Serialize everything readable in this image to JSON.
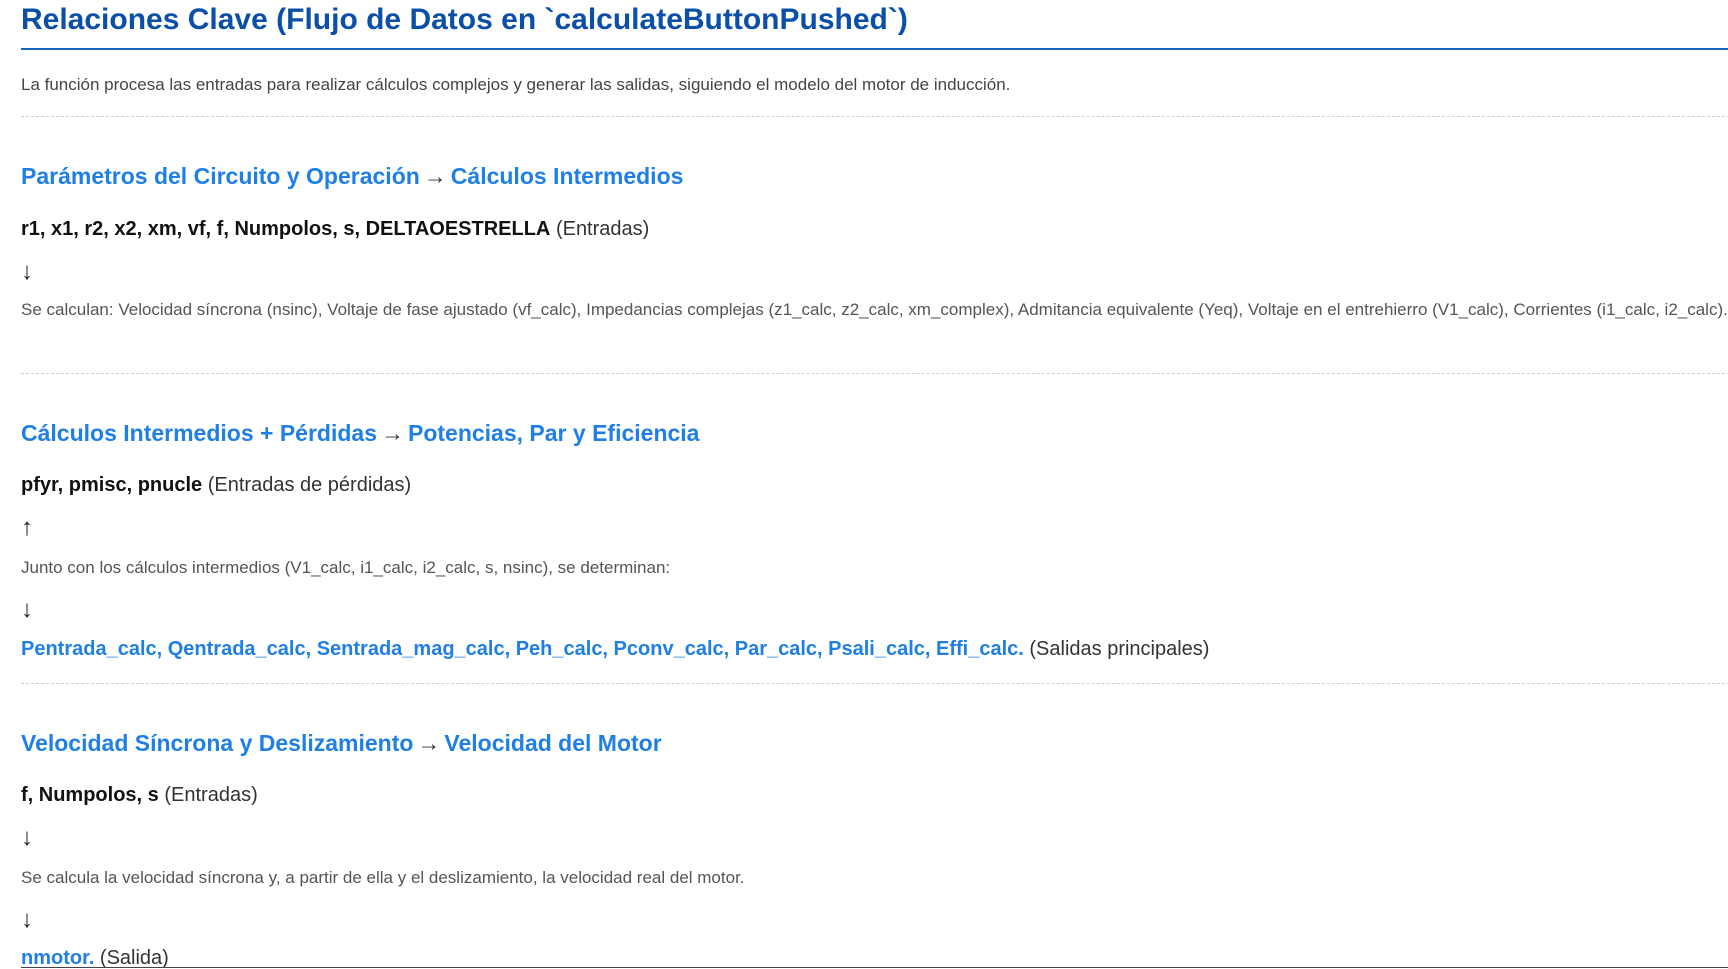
{
  "title": "Relaciones Clave (Flujo de Datos en `calculateButtonPushed`)",
  "intro": "La función procesa las entradas para realizar cálculos complejos y generar las salidas, siguiendo el modelo del motor de inducción.",
  "sections": [
    {
      "title_from": "Parámetros del Circuito y Operación",
      "arrow": "→",
      "title_to": "Cálculos Intermedios",
      "inputs_vars": "r1, x1, r2, x2, xm, vf, f, Numpolos, s, DELTAOESTRELLA",
      "inputs_note": "(Entradas)",
      "flow_arrow_1": "↓",
      "description": "Se calculan: Velocidad síncrona (nsinc), Voltaje de fase ajustado (vf_calc), Impedancias complejas (z1_calc, z2_calc, xm_complex), Admitancia equivalente (Yeq), Voltaje en el entrehierro (V1_calc), Corrientes (i1_calc, i2_calc)."
    },
    {
      "title_from": "Cálculos Intermedios + Pérdidas",
      "arrow": "→",
      "title_to": "Potencias, Par y Eficiencia",
      "inputs_vars": "pfyr, pmisc, pnucle",
      "inputs_note": "(Entradas de pérdidas)",
      "flow_arrow_1": "↑",
      "description": "Junto con los cálculos intermedios (V1_calc, i1_calc, i2_calc, s, nsinc), se determinan:",
      "flow_arrow_2": "↓",
      "outputs_vars": "Pentrada_calc, Qentrada_calc, Sentrada_mag_calc, Peh_calc, Pconv_calc, Par_calc, Psali_calc, Effi_calc.",
      "outputs_note": "(Salidas principales)"
    },
    {
      "title_from": "Velocidad Síncrona y Deslizamiento",
      "arrow": "→",
      "title_to": "Velocidad del Motor",
      "inputs_vars": "f, Numpolos, s",
      "inputs_note": "(Entradas)",
      "flow_arrow_1": "↓",
      "description": "Se calcula la velocidad síncrona y, a partir de ella y el deslizamiento, la velocidad real del motor.",
      "flow_arrow_2": "↓",
      "outputs_vars": "nmotor.",
      "outputs_note": "(Salida)"
    }
  ]
}
